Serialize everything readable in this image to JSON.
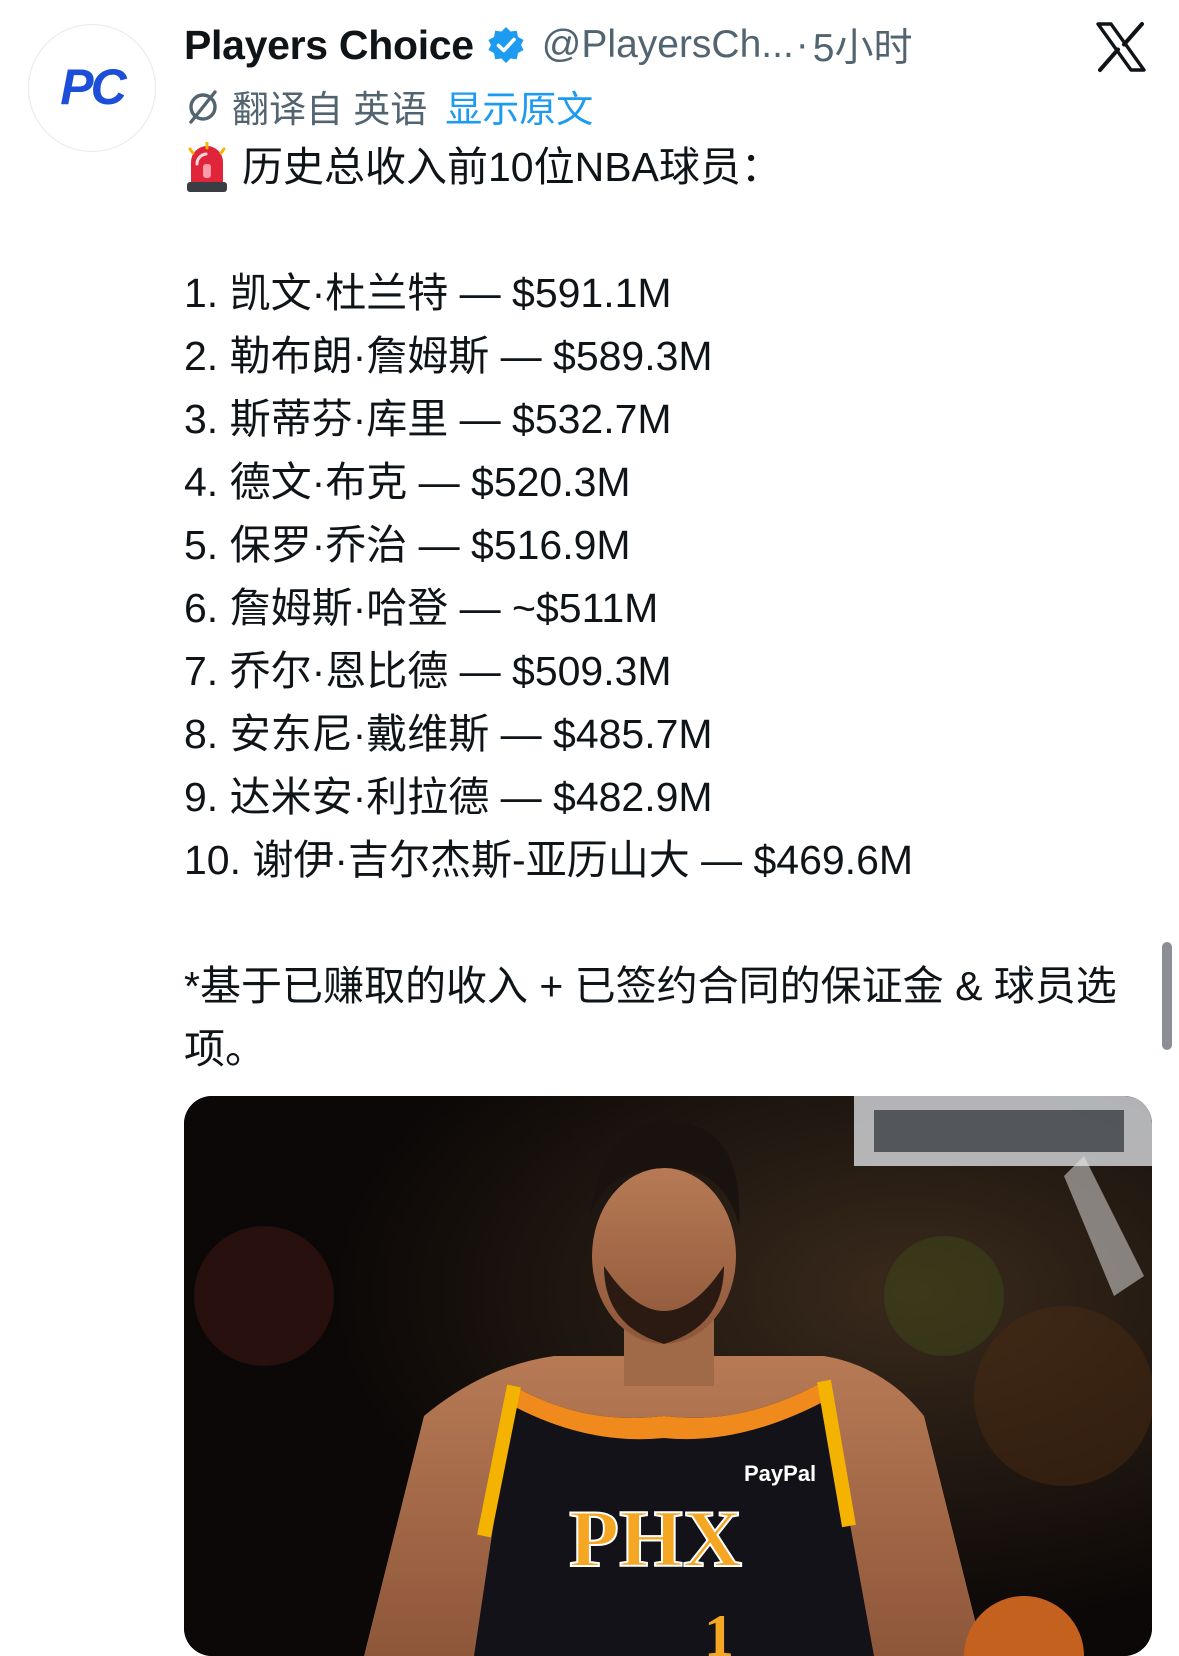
{
  "author": {
    "avatar_text": "PC",
    "name": "Players Choice",
    "handle": "@PlayersCh...",
    "separator": "·",
    "time": "5小时"
  },
  "translation": {
    "label": "翻译自 英语",
    "show_original": "显示原文"
  },
  "tweet": {
    "heading": "历史总收入前10位NBA球员：",
    "rankings": [
      "1. 凯文·杜兰特 — $591.1M",
      "2. 勒布朗·詹姆斯 — $589.3M",
      "3. 斯蒂芬·库里 — $532.7M",
      "4. 德文·布克 — $520.3M",
      "5. 保罗·乔治 — $516.9M",
      "6. 詹姆斯·哈登 — ~$511M",
      "7. 乔尔·恩比德 — $509.3M",
      "8. 安东尼·戴维斯 — $485.7M",
      "9. 达米安·利拉德 — $482.9M",
      "10. 谢伊·吉尔杰斯-亚历山大 — $469.6M"
    ],
    "footnote": "*基于已赚取的收入 + 已签约合同的保证金 & 球员选项。"
  },
  "media": {
    "jersey_text": "PHX",
    "sponsor_text": "PayPal",
    "jersey_number": "1"
  },
  "colors": {
    "accent": "#1d9bf0",
    "secondary_text": "#536471",
    "brand_blue": "#1d4ed8"
  },
  "icons": {
    "verified": "verified-badge-icon",
    "close": "x-logo-icon",
    "translate": "translate-icon",
    "siren": "siren-emoji-icon"
  }
}
